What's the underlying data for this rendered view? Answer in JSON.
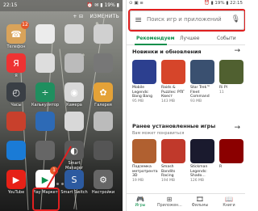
{
  "left": {
    "status_time": "22:15",
    "status_right": "⏰ ✉ ▮ 19% ▮",
    "actions": [
      "+ ⊟",
      "ИЗМЕНИТЬ"
    ],
    "apps": [
      {
        "label": "Телефон",
        "color": "#d9a35a",
        "icon": "phone-icon"
      },
      {
        "label": "",
        "color": "#ececec",
        "icon": "blank-icon"
      },
      {
        "label": "",
        "color": "#d8d8d8",
        "icon": "blank-icon"
      },
      {
        "label": "",
        "color": "#d0d0d0",
        "icon": "blank-icon"
      },
      {
        "label": "Я",
        "color": "#e33",
        "icon": "yandex-icon"
      },
      {
        "label": "",
        "color": "#ddd",
        "icon": "blank-icon"
      },
      {
        "label": "",
        "color": "#bbb",
        "icon": "blank-icon"
      },
      {
        "label": "",
        "color": "#777",
        "icon": "blank-icon"
      },
      {
        "label": "Часы",
        "color": "#3a3f45",
        "icon": "clock-icon"
      },
      {
        "label": "Калькулятор",
        "color": "#1f8f5f",
        "icon": "calculator-icon"
      },
      {
        "label": "Камера",
        "color": "#d8d8d8",
        "icon": "camera-icon"
      },
      {
        "label": "Галерея",
        "color": "#e4a238",
        "icon": "gallery-icon"
      },
      {
        "label": "",
        "color": "#c8402c",
        "icon": "blank-icon"
      },
      {
        "label": "",
        "color": "#2d6ab6",
        "icon": "blank-icon"
      },
      {
        "label": "",
        "color": "#d8d8d8",
        "icon": "blank-icon"
      },
      {
        "label": "",
        "color": "#bbb",
        "icon": "blank-icon"
      },
      {
        "label": "",
        "color": "#1a7bd6",
        "icon": "blank-icon"
      },
      {
        "label": "",
        "color": "#666",
        "icon": "blank-icon"
      },
      {
        "label": "Smart Manager",
        "color": "#5a5a5a",
        "icon": "smart-manager-icon"
      },
      {
        "label": "",
        "color": "#555",
        "icon": "blank-icon"
      },
      {
        "label": "YouTube",
        "color": "#e62117",
        "icon": "youtube-icon"
      },
      {
        "label": "Play Маркет",
        "color": "#ffffff",
        "icon": "play-store-icon"
      },
      {
        "label": "Smart Switch",
        "color": "#2c5aa0",
        "icon": "smart-switch-icon"
      },
      {
        "label": "Настройки",
        "color": "#666",
        "icon": "settings-icon"
      }
    ],
    "badge_phone": "12",
    "badge_store": "1"
  },
  "right": {
    "status_left": "⊙ ▣ ≡",
    "status_right": "⏰ ▮ 19% ▮ 22:15",
    "search_placeholder": "Поиск игр и приложений",
    "tabs": [
      "Рекомендуем",
      "Лучшее",
      "Событи"
    ],
    "section1": {
      "title": "Новинки и обновления",
      "arrow": "→"
    },
    "section1_apps": [
      {
        "name": "Mobile Legends: Bang Bang",
        "size": "95 MB",
        "color": "#2c3f8f"
      },
      {
        "name": "Raids & Puzzles: РПГ Квест",
        "size": "143 MB",
        "color": "#d6452a"
      },
      {
        "name": "Star Trek™ Fleet Command",
        "size": "93 MB",
        "color": "#3a5070"
      },
      {
        "name": "Ri Pl",
        "size": "11",
        "color": "#506030"
      }
    ],
    "section2": {
      "title": "Ранее установленные игры",
      "subtitle": "Вам может понравиться",
      "arrow": "→"
    },
    "section2_apps": [
      {
        "name": "Подземка метротрента 3D",
        "size": "19 MB",
        "color": "#b06030"
      },
      {
        "name": "Smash Bandits Racing",
        "size": "194 MB",
        "color": "#c0392b"
      },
      {
        "name": "Stickman Legends: Shado...",
        "size": "126 MB",
        "color": "#1a1a2e"
      },
      {
        "name": "R",
        "size": "",
        "color": "#8b0000"
      }
    ],
    "bottom_nav": [
      {
        "label": "Игры",
        "icon": "gamepad-icon"
      },
      {
        "label": "Приложен...",
        "icon": "apps-icon"
      },
      {
        "label": "Фильмы",
        "icon": "film-icon"
      },
      {
        "label": "Книги",
        "icon": "book-icon"
      }
    ]
  }
}
